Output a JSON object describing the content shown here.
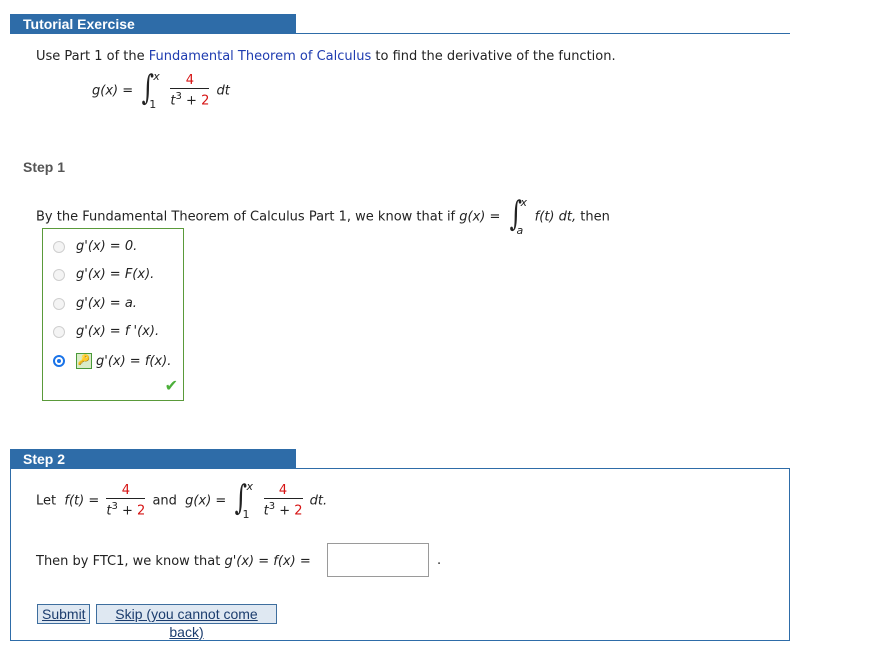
{
  "header": {
    "title": "Tutorial Exercise"
  },
  "intro": {
    "prefix": "Use Part 1 of the ",
    "link": "Fundamental Theorem of Calculus",
    "suffix": " to find the derivative of the function."
  },
  "function": {
    "lhs": "g(x) =",
    "upper": "x",
    "lower": "1",
    "numerator": "4",
    "den_var": "t",
    "den_exp": "3",
    "den_plus": " + ",
    "den_const": "2",
    "dt": "dt"
  },
  "step1": {
    "label": "Step 1",
    "text": "By the Fundamental Theorem of Calculus Part 1, we know that if ",
    "lhs": "g(x) =",
    "upper": "x",
    "lower": "a",
    "integrand": "f(t) dt,",
    "then": "then",
    "choices": [
      {
        "text": "g'(x) = 0.",
        "selected": false
      },
      {
        "text": "g'(x) = F(x).",
        "selected": false
      },
      {
        "text": "g'(x) = a.",
        "selected": false
      },
      {
        "text": "g'(x) = f '(x).",
        "selected": false
      },
      {
        "text": "g'(x) = f(x).",
        "selected": true
      }
    ],
    "key_icon": "🔑",
    "check_icon": "✔"
  },
  "step2": {
    "label": "Step 2",
    "let": "Let",
    "f_lhs": "f(t) =",
    "and": "and",
    "g_lhs": "g(x) =",
    "dt": "dt.",
    "then_text": "Then by FTC1, we know that ",
    "then_math": "g'(x) = f(x) =",
    "answer_value": "",
    "period": ".",
    "submit_label": "Submit",
    "skip_label": "Skip (you cannot come back)"
  },
  "colors": {
    "accent": "#2e6ca8",
    "highlight": "#d61414",
    "correct": "#4caf3a"
  }
}
